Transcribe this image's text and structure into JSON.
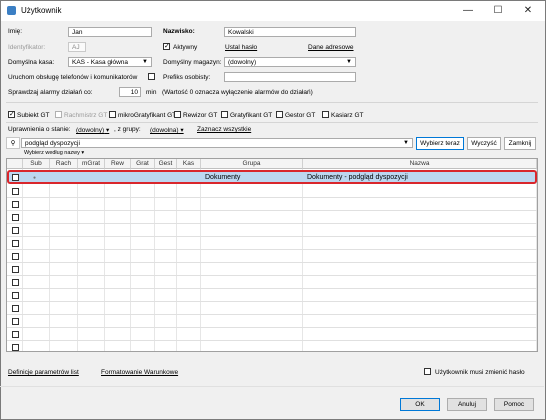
{
  "window": {
    "title": "Użytkownik",
    "minimize": "—",
    "maximize": "☐",
    "close": "✕"
  },
  "form": {
    "imie_label": "Imię:",
    "imie_value": "Jan",
    "identyfikator_label": "Identyfikator:",
    "identyfikator_value": "AJ",
    "domyslna_kasa_label": "Domyślna kasa:",
    "domyslna_kasa_value": "KAS - Kasa główna",
    "uruchom_label": "Uruchom obsługę telefonów i komunikatorów",
    "sprawdzaj_label": "Sprawdzaj alarmy działań co:",
    "sprawdzaj_value": "10",
    "min_label": "min",
    "sprawdzaj_note": "(Wartość 0 oznacza wyłączenie alarmów do działań)",
    "nazwisko_label": "Nazwisko:",
    "nazwisko_value": "Kowalski",
    "aktywny_label": "Aktywny",
    "ustal_haslo": "Ustal hasło",
    "dane_adresowe": "Dane adresowe",
    "domyslny_magazyn_label": "Domyślny magazyn:",
    "domyslny_magazyn_value": "(dowolny)",
    "prefiks_label": "Prefiks osobisty:",
    "prefiks_value": ""
  },
  "modules": [
    {
      "label": "Subiekt GT",
      "checked": true,
      "disabled": false
    },
    {
      "label": "Rachmistrz GT",
      "checked": false,
      "disabled": true
    },
    {
      "label": "mikroGratyfikant GT",
      "checked": false,
      "disabled": false
    },
    {
      "label": "Rewizor GT",
      "checked": false,
      "disabled": false
    },
    {
      "label": "Gratyfikant GT",
      "checked": false,
      "disabled": false
    },
    {
      "label": "Gestor GT",
      "checked": false,
      "disabled": false
    },
    {
      "label": "Kasiarz GT",
      "checked": false,
      "disabled": false
    }
  ],
  "permissions": {
    "stan_label": "Uprawnienia o stanie:",
    "stan_value": "(dowolny)",
    "grupy_label": ", z grupy:",
    "grupy_value": "(dowolna)",
    "zaznacz_label": "Zaznacz wszystkie",
    "search_value": "podgląd dyspozycji",
    "wybierz_teraz": "Wybierz teraz",
    "wyczysc": "Wyczyść",
    "zamknij": "Zamknij",
    "wybierz_wedlug": "Wybierz według nazwy"
  },
  "table": {
    "columns": [
      "Sub",
      "Rach",
      "mGrat",
      "Rew",
      "Grat",
      "Gest",
      "Kas",
      "Grupa",
      "Nazwa"
    ],
    "rows": [
      {
        "sub": "●",
        "grupa": "Dokumenty",
        "nazwa": "Dokumenty - podgląd dyspozycji"
      }
    ],
    "empty_rows": 13
  },
  "footer": {
    "definicje": "Definicje parametrów list",
    "formatowanie": "Formatowanie Warunkowe",
    "musi_zmienic": "Użytkownik musi zmienić hasło",
    "ok": "OK",
    "anuluj": "Anuluj",
    "pomoc": "Pomoc"
  },
  "colors": {
    "selection": "#bcd7f0",
    "highlight_border": "#d9262c",
    "link_blue": "#0078d7"
  }
}
